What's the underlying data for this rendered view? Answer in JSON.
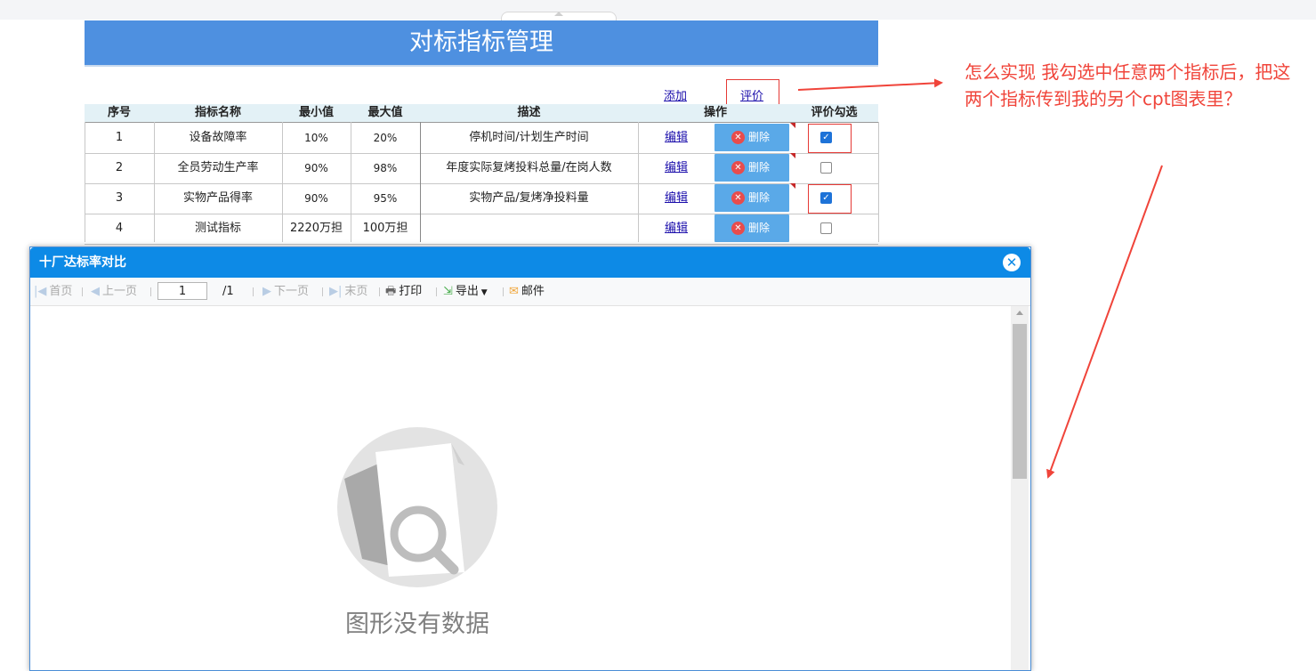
{
  "report": {
    "title": "对标指标管理",
    "add_link": "添加",
    "evaluate_link": "评价"
  },
  "table": {
    "headers": [
      "序号",
      "指标名称",
      "最小值",
      "最大值",
      "描述",
      "操作",
      "评价勾选"
    ],
    "edit_label": "编辑",
    "delete_label": "删除",
    "rows": [
      {
        "no": "1",
        "name": "设备故障率",
        "min": "10%",
        "max": "20%",
        "desc": "停机时间/计划生产时间",
        "checked": true
      },
      {
        "no": "2",
        "name": "全员劳动生产率",
        "min": "90%",
        "max": "98%",
        "desc": "年度实际复烤投料总量/在岗人数",
        "checked": false
      },
      {
        "no": "3",
        "name": "实物产品得率",
        "min": "90%",
        "max": "95%",
        "desc": "实物产品/复烤净投料量",
        "checked": true
      },
      {
        "no": "4",
        "name": "测试指标",
        "min": "2220万担",
        "max": "100万担",
        "desc": "",
        "checked": false
      }
    ]
  },
  "annotation": {
    "text": "怎么实现 我勾选中任意两个指标后，把这两个指标传到我的另个cpt图表里？",
    "color": "#f0443a"
  },
  "dialog": {
    "title": "十厂达标率对比",
    "toolbar": {
      "first": "首页",
      "prev": "上一页",
      "page_value": "1",
      "page_total": "/1",
      "next": "下一页",
      "last": "末页",
      "print": "打印",
      "export": "导出",
      "email": "邮件"
    },
    "empty_text": "图形没有数据"
  },
  "colors": {
    "title_bar": "#4e90e0",
    "dialog_header": "#0d8ae6",
    "delete_button": "#5aa9e8",
    "highlight_red": "#e53935"
  }
}
